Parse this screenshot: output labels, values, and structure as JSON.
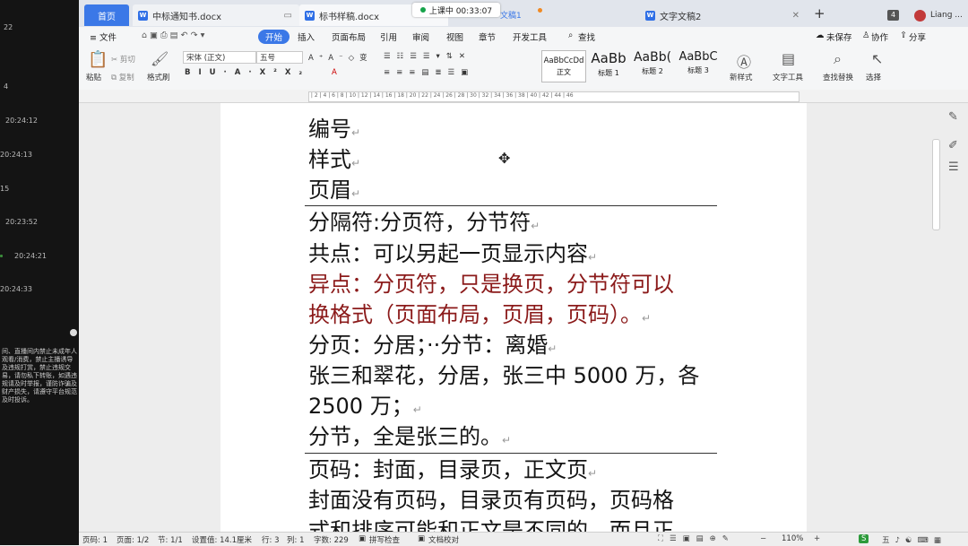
{
  "left_panel": {
    "top_label": "22",
    "timestamps": [
      "4",
      "20:24:12",
      "20:24:13",
      "15",
      "20:23:52",
      "20:24:21",
      "20:24:33"
    ],
    "notice": "间、直播间内禁止未成年人观看/消费，禁止主播诱导及违规打赏，禁止违规交易，请勿私下转账，如遇违规请及时举报，谨防诈骗及财产损失，请遵守平台规范及时投诉。"
  },
  "tabs": {
    "home": "首页",
    "doc1": "中标通知书.docx",
    "doc2": "标书样稿.docx",
    "doc3_partial": "文稿1",
    "doc4": "文字文稿2",
    "add": "+",
    "badge_count": "4",
    "user": "Liang ..."
  },
  "live_badge": "上课中 00:33:07",
  "menu": {
    "file": "≡ 文件",
    "items": [
      "开始",
      "插入",
      "页面布局",
      "引用",
      "审阅",
      "视图",
      "章节",
      "开发工具"
    ],
    "search": "查找",
    "unsaved": "未保存",
    "collab": "协作",
    "share": "分享"
  },
  "ribbon": {
    "paste": "粘贴",
    "cut": "剪切",
    "copy": "复制",
    "format_painter": "格式刷",
    "font_name": "宋体 (正文)",
    "font_size": "五号",
    "styles": [
      {
        "preview": "AaBbCcDd",
        "label": "正文"
      },
      {
        "preview": "AaBb",
        "label": "标题 1"
      },
      {
        "preview": "AaBb(",
        "label": "标题 2"
      },
      {
        "preview": "AaBbC",
        "label": "标题 3"
      }
    ],
    "new_style": "新样式",
    "text_tools": "文字工具",
    "find_replace": "查找替换",
    "select": "选择"
  },
  "document": {
    "lines": [
      {
        "text": "编号",
        "color": "black"
      },
      {
        "text": "样式",
        "color": "black"
      },
      {
        "text": "页眉",
        "color": "black"
      },
      {
        "text": "分隔符:分页符，分节符",
        "color": "black"
      },
      {
        "text": "共点：可以另起一页显示内容",
        "color": "black"
      },
      {
        "text": "异点：分页符，只是换页，分节符可以",
        "color": "red"
      },
      {
        "text": "换格式（页面布局，页眉，页码）。",
        "color": "red"
      },
      {
        "text": "分页：分居；··分节：离婚",
        "color": "black"
      },
      {
        "text": "张三和翠花，分居，张三中 5000 万，各",
        "color": "black"
      },
      {
        "text": "2500 万；",
        "color": "black"
      },
      {
        "text": "分节，全是张三的。",
        "color": "black"
      },
      {
        "text": "页码：封面，目录页，正文页",
        "color": "black"
      },
      {
        "text": "封面没有页码，目录页有页码，页码格",
        "color": "black"
      },
      {
        "text": "式和排序可能和正文是不同的，而且正",
        "color": "black"
      }
    ]
  },
  "status": {
    "page_num": "页码: 1",
    "pages": "页面: 1/2",
    "section": "节: 1/1",
    "setting": "设置值: 14.1厘米",
    "row": "行: 3",
    "col": "列: 1",
    "words": "字数: 229",
    "spell": "拼写检查",
    "proof": "文档校对",
    "zoom": "110%"
  },
  "colors": {
    "accent": "#3b78e7",
    "red_text": "#8b1a1a"
  }
}
